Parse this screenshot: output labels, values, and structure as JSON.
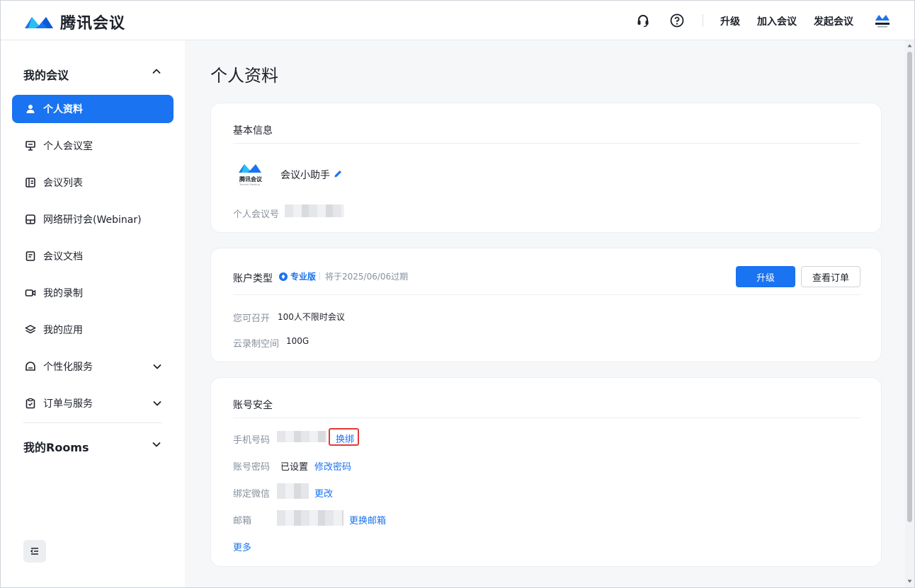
{
  "header": {
    "brand": "腾讯会议",
    "links": {
      "upgrade": "升级",
      "join": "加入会议",
      "start": "发起会议"
    },
    "avatar_text": "腾讯会议"
  },
  "sidebar": {
    "my_meetings": "我的会议",
    "items": [
      {
        "label": "个人资料",
        "icon": "user-icon"
      },
      {
        "label": "个人会议室",
        "icon": "monitor-icon"
      },
      {
        "label": "会议列表",
        "icon": "list-icon"
      },
      {
        "label": "网络研讨会(Webinar)",
        "icon": "webinar-icon"
      },
      {
        "label": "会议文档",
        "icon": "document-icon"
      },
      {
        "label": "我的录制",
        "icon": "video-icon"
      },
      {
        "label": "我的应用",
        "icon": "layers-icon"
      },
      {
        "label": "个性化服务",
        "icon": "service-icon"
      },
      {
        "label": "订单与服务",
        "icon": "clipboard-icon"
      }
    ],
    "my_rooms": "我的Rooms"
  },
  "main": {
    "title": "个人资料",
    "basic": {
      "title": "基本信息",
      "avatar_brand": "腾讯会议",
      "avatar_sub": "Tencent Meeting",
      "nickname": "会议小助手",
      "meeting_id_label": "个人会议号"
    },
    "account": {
      "type_label": "账户类型",
      "plan": "专业版",
      "expire": "将于2025/06/06过期",
      "upgrade_btn": "升级",
      "orders_btn": "查看订单",
      "can_host_label": "您可召开",
      "can_host_value": "100人不限时会议",
      "cloud_label": "云录制空间",
      "cloud_value": "100G"
    },
    "security": {
      "title": "账号安全",
      "phone_label": "手机号码",
      "phone_action": "换绑",
      "password_label": "账号密码",
      "password_value": "已设置",
      "password_action": "修改密码",
      "wechat_label": "绑定微信",
      "wechat_action": "更改",
      "email_label": "邮箱",
      "email_action": "更换邮箱",
      "more": "更多"
    }
  },
  "colors": {
    "accent": "#1a73f0",
    "highlight": "#e53935",
    "background": "#f6f7f9"
  }
}
